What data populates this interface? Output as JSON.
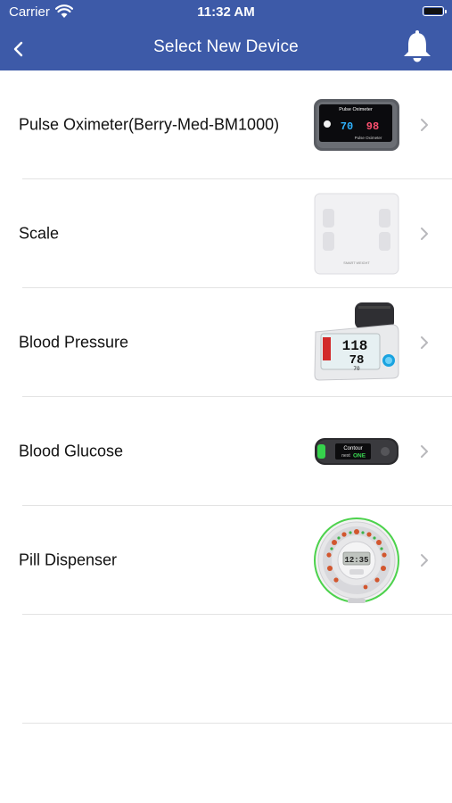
{
  "status_bar": {
    "carrier": "Carrier",
    "time": "11:32 AM"
  },
  "header": {
    "title": "Select New Device",
    "accent_color": "#3d5aa8"
  },
  "devices": [
    {
      "label": "Pulse Oximeter(Berry-Med-BM1000)",
      "image_text": [
        "Pulse Oximeter",
        "70",
        "98",
        "Pulse Oximeter"
      ]
    },
    {
      "label": "Scale",
      "image_text": [
        "SMART WEIGHT"
      ]
    },
    {
      "label": "Blood Pressure",
      "image_text": [
        "118",
        "78",
        "70"
      ]
    },
    {
      "label": "Blood Glucose",
      "image_text": [
        "Contour",
        "next",
        "ONE"
      ]
    },
    {
      "label": "Pill Dispenser",
      "image_text": [
        "12:35"
      ]
    }
  ]
}
